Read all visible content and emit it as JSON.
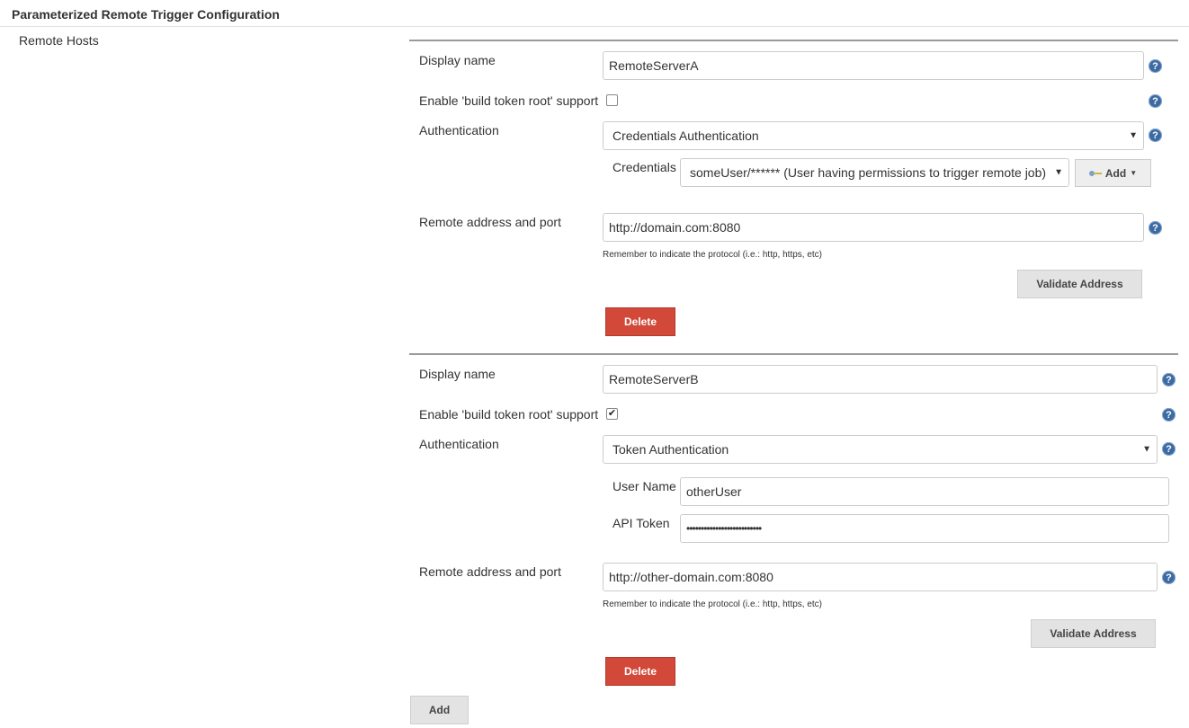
{
  "section": {
    "title": "Parameterized Remote Trigger Configuration",
    "remote_hosts_label": "Remote Hosts"
  },
  "labels": {
    "display_name": "Display name",
    "enable_build_token_root": "Enable 'build token root' support",
    "authentication": "Authentication",
    "credentials": "Credentials",
    "user_name": "User Name",
    "api_token": "API Token",
    "remote_address": "Remote address and port",
    "protocol_hint": "Remember to indicate the protocol (i.e.: http, https, etc)"
  },
  "buttons": {
    "validate_address": "Validate Address",
    "delete": "Delete",
    "add": "Add",
    "add_credentials": "Add"
  },
  "help_icon_glyph": "?",
  "check_glyph": "✔",
  "hosts": [
    {
      "display_name": "RemoteServerA",
      "build_token_root_enabled": false,
      "authentication": "Credentials Authentication",
      "credentials": "someUser/****** (User having permissions to trigger remote job)",
      "remote_address": "http://domain.com:8080"
    },
    {
      "display_name": "RemoteServerB",
      "build_token_root_enabled": true,
      "authentication": "Token Authentication",
      "user_name": "otherUser",
      "api_token": "••••••••••••••••••••••••••",
      "remote_address": "http://other-domain.com:8080"
    }
  ],
  "colors": {
    "help_icon": "#3c6aa3",
    "delete_button": "#d24939",
    "grey_button": "#e3e3e3"
  }
}
